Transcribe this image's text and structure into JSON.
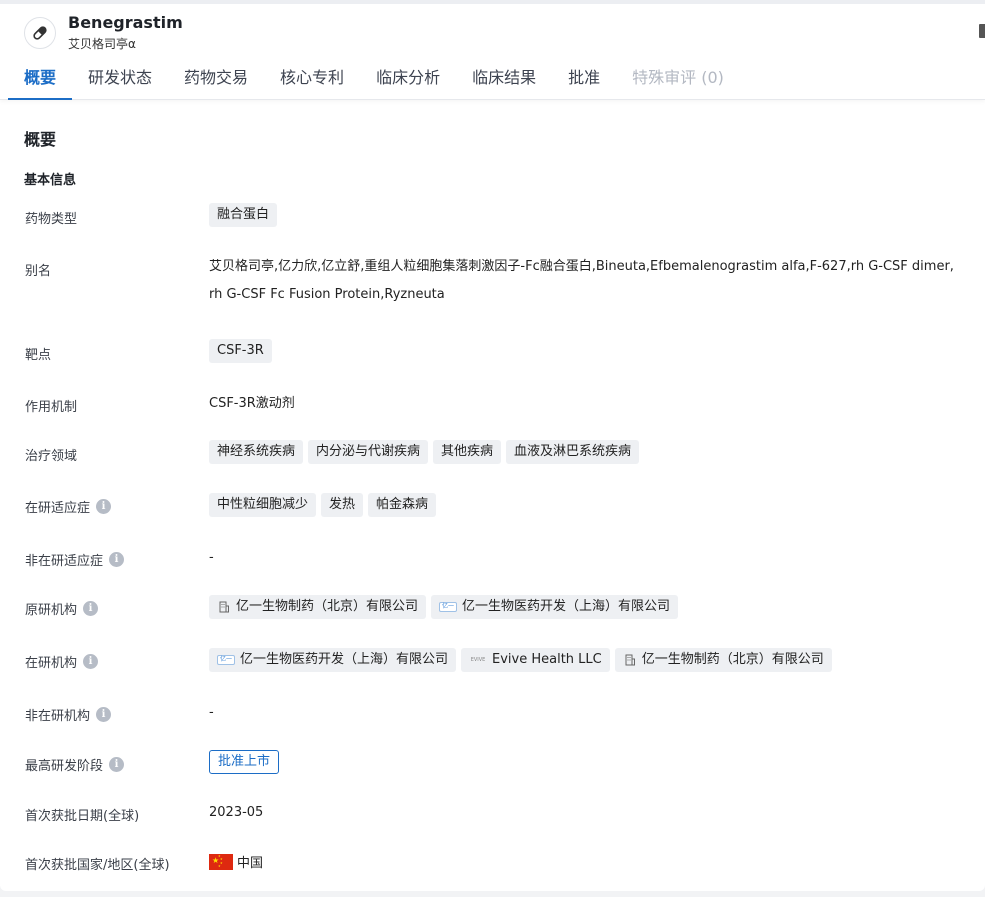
{
  "header": {
    "drug_name": "Benegrastim",
    "drug_subtitle": "艾贝格司亭α",
    "drug_icon": "pill-icon"
  },
  "tabs": [
    {
      "label": "概要",
      "active": true
    },
    {
      "label": "研发状态"
    },
    {
      "label": "药物交易"
    },
    {
      "label": "核心专利"
    },
    {
      "label": "临床分析"
    },
    {
      "label": "临床结果"
    },
    {
      "label": "批准"
    },
    {
      "label": "特殊审评 (0)",
      "disabled": true
    }
  ],
  "overview": {
    "title": "概要",
    "basic_info_title": "基本信息",
    "fields": {
      "drug_type": {
        "label": "药物类型",
        "tags": [
          "融合蛋白"
        ]
      },
      "aliases": {
        "label": "别名",
        "lines": [
          "艾贝格司亭,亿力欣,亿立舒,重组人粒细胞集落刺激因子-Fc融合蛋白,Bineuta,Efbemalenograstim alfa,F-627,rh G-CSF dimer,",
          "rh G-CSF Fc Fusion Protein,Ryzneuta"
        ]
      },
      "target": {
        "label": "靶点",
        "tags": [
          "CSF-3R"
        ]
      },
      "mechanism": {
        "label": "作用机制",
        "value": "CSF-3R激动剂"
      },
      "therapeutic_area": {
        "label": "治疗领域",
        "tags": [
          "神经系统疾病",
          "内分泌与代谢疾病",
          "其他疾病",
          "血液及淋巴系统疾病"
        ]
      },
      "active_indications": {
        "label": "在研适应症",
        "tags": [
          "中性粒细胞减少",
          "发热",
          "帕金森病"
        ]
      },
      "inactive_indications": {
        "label": "非在研适应症",
        "value": "-"
      },
      "originator": {
        "label": "原研机构",
        "orgs": [
          {
            "name": "亿一生物制药（北京）有限公司",
            "icon": "building-icon"
          },
          {
            "name": "亿一生物医药开发（上海）有限公司",
            "icon": "company-logo-icon"
          }
        ]
      },
      "active_orgs": {
        "label": "在研机构",
        "orgs": [
          {
            "name": "亿一生物医药开发（上海）有限公司",
            "icon": "company-logo-icon"
          },
          {
            "name": "Evive Health LLC",
            "icon": "evive-logo-icon"
          },
          {
            "name": "亿一生物制药（北京）有限公司",
            "icon": "building-icon"
          }
        ]
      },
      "inactive_orgs": {
        "label": "非在研机构",
        "value": "-"
      },
      "highest_phase": {
        "label": "最高研发阶段",
        "value": "批准上市"
      },
      "first_approval_date": {
        "label": "首次获批日期(全球)",
        "value": "2023-05"
      },
      "first_approval_country": {
        "label": "首次获批国家/地区(全球)",
        "value": "中国",
        "flag": "china-flag-icon"
      }
    }
  },
  "icons": {
    "info": "i",
    "logo_text": "亿一",
    "evive_text": "EVIVE"
  },
  "colors": {
    "accent": "#1c6dc6",
    "tag_bg": "#eef0f3",
    "disabled": "#b3b8c2"
  }
}
